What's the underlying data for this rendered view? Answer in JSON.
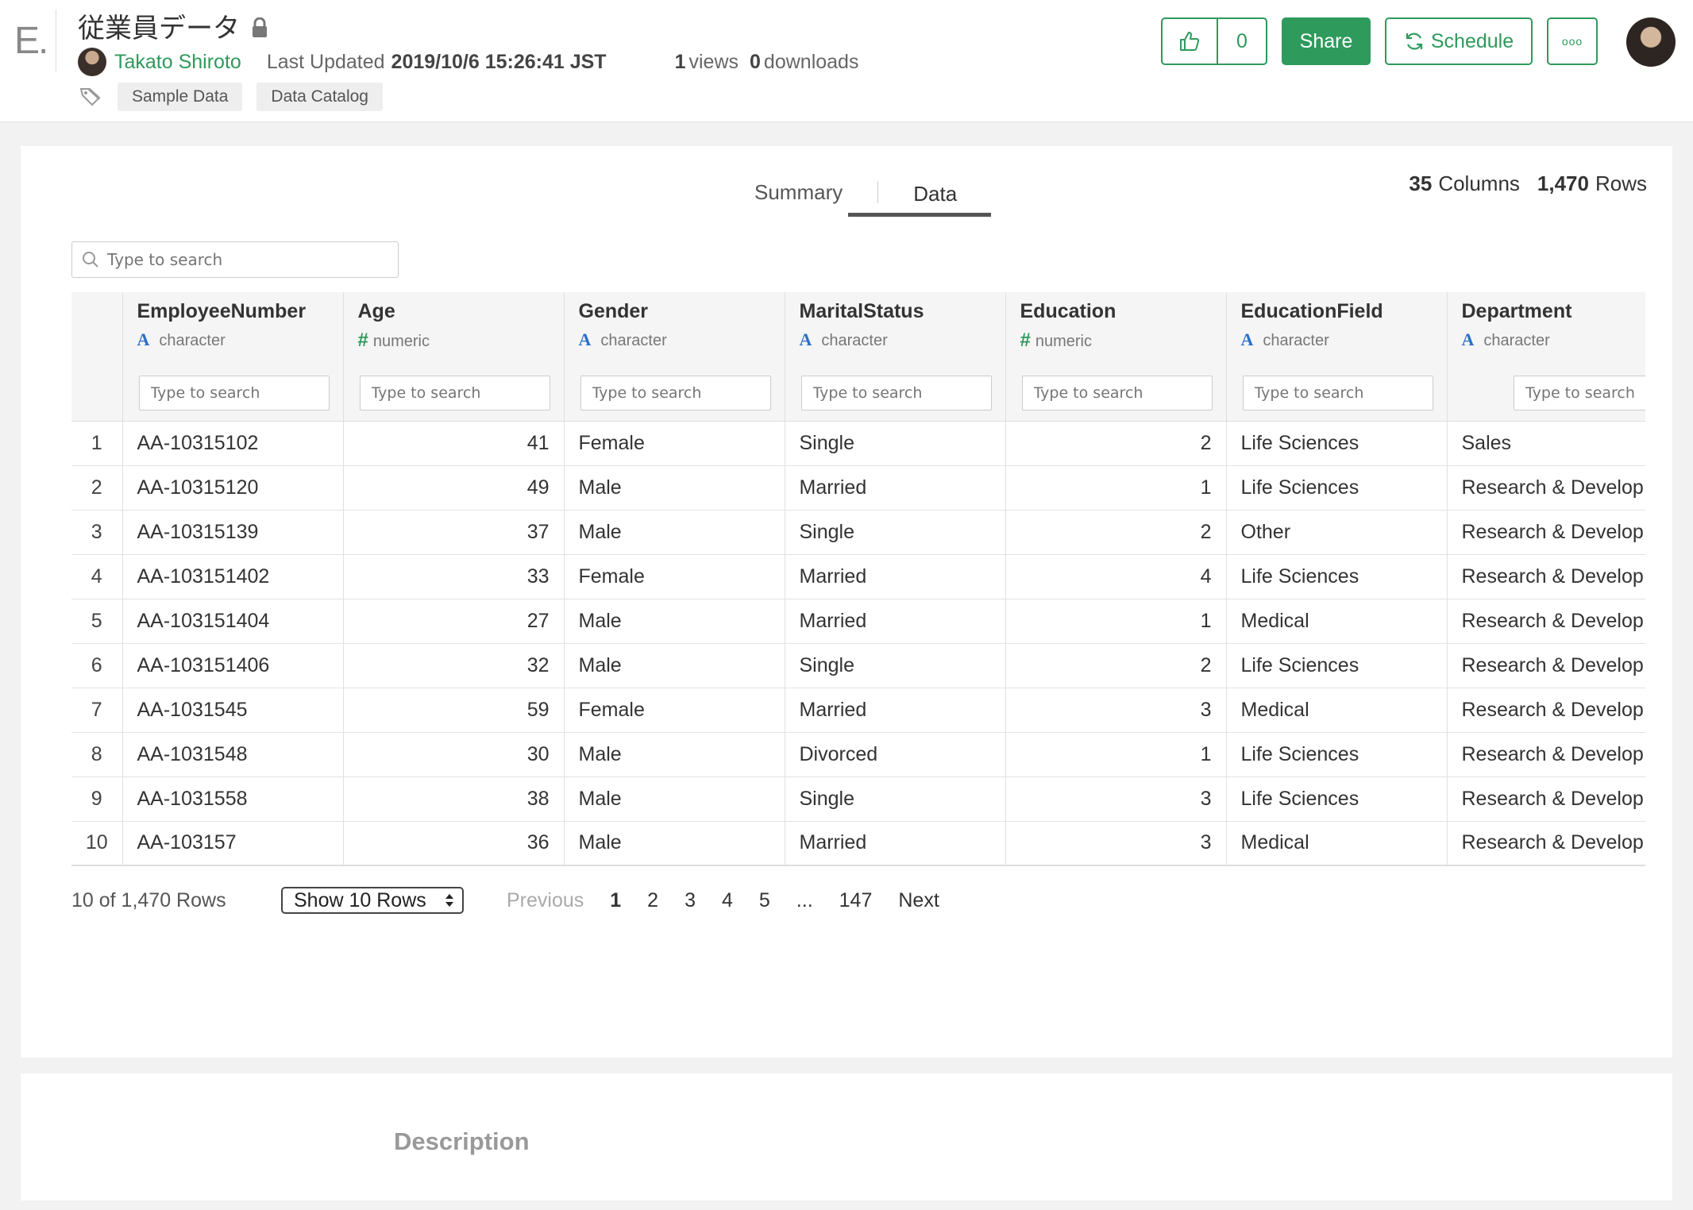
{
  "header": {
    "logo": "E.",
    "title": "従業員データ",
    "author": "Takato Shiroto",
    "updated_label": "Last Updated",
    "updated_value": "2019/10/6 15:26:41 JST",
    "views_count": "1",
    "views_label": "views",
    "downloads_count": "0",
    "downloads_label": "downloads",
    "tags": [
      "Sample Data",
      "Data Catalog"
    ],
    "like_count": "0",
    "share_label": "Share",
    "schedule_label": "Schedule",
    "more_label": "ooo"
  },
  "tabs": {
    "summary": "Summary",
    "data": "Data"
  },
  "counts": {
    "columns_num": "35",
    "columns_label": "Columns",
    "rows_num": "1,470",
    "rows_label": "Rows"
  },
  "search": {
    "placeholder": "Type to search"
  },
  "table": {
    "columns": [
      {
        "name": "EmployeeNumber",
        "type": "character",
        "numeric": false
      },
      {
        "name": "Age",
        "type": "numeric",
        "numeric": true
      },
      {
        "name": "Gender",
        "type": "character",
        "numeric": false
      },
      {
        "name": "MaritalStatus",
        "type": "character",
        "numeric": false
      },
      {
        "name": "Education",
        "type": "numeric",
        "numeric": true
      },
      {
        "name": "EducationField",
        "type": "character",
        "numeric": false
      },
      {
        "name": "Department",
        "type": "character",
        "numeric": false
      }
    ],
    "col_search_placeholder": "Type to search",
    "rows": [
      [
        "1",
        "AA-10315102",
        "41",
        "Female",
        "Single",
        "2",
        "Life Sciences",
        "Sales"
      ],
      [
        "2",
        "AA-10315120",
        "49",
        "Male",
        "Married",
        "1",
        "Life Sciences",
        "Research & Develop"
      ],
      [
        "3",
        "AA-10315139",
        "37",
        "Male",
        "Single",
        "2",
        "Other",
        "Research & Develop"
      ],
      [
        "4",
        "AA-103151402",
        "33",
        "Female",
        "Married",
        "4",
        "Life Sciences",
        "Research & Develop"
      ],
      [
        "5",
        "AA-103151404",
        "27",
        "Male",
        "Married",
        "1",
        "Medical",
        "Research & Develop"
      ],
      [
        "6",
        "AA-103151406",
        "32",
        "Male",
        "Single",
        "2",
        "Life Sciences",
        "Research & Develop"
      ],
      [
        "7",
        "AA-1031545",
        "59",
        "Female",
        "Married",
        "3",
        "Medical",
        "Research & Develop"
      ],
      [
        "8",
        "AA-1031548",
        "30",
        "Male",
        "Divorced",
        "1",
        "Life Sciences",
        "Research & Develop"
      ],
      [
        "9",
        "AA-1031558",
        "38",
        "Male",
        "Single",
        "3",
        "Life Sciences",
        "Research & Develop"
      ],
      [
        "10",
        "AA-103157",
        "36",
        "Male",
        "Married",
        "3",
        "Medical",
        "Research & Develop"
      ]
    ]
  },
  "pager": {
    "row_info": "10 of 1,470 Rows",
    "show_rows": "Show 10 Rows",
    "previous": "Previous",
    "pages": [
      "1",
      "2",
      "3",
      "4",
      "5",
      "...",
      "147"
    ],
    "current": "1",
    "next": "Next"
  },
  "description": {
    "title": "Description"
  },
  "colors": {
    "accent": "#2e9a5c",
    "type_char": "#2b6fc9"
  }
}
